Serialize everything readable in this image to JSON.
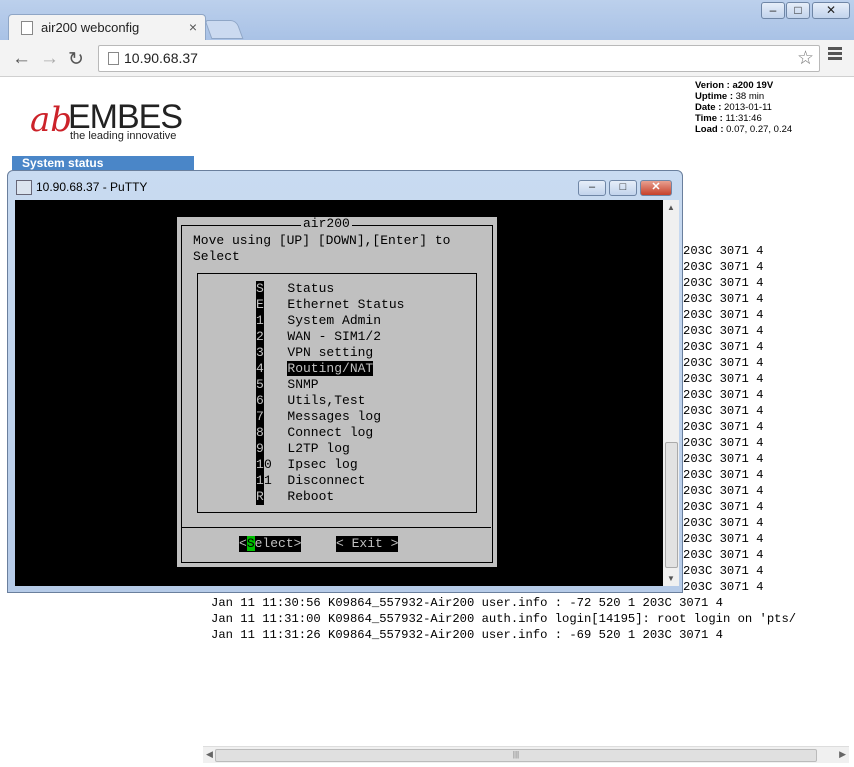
{
  "browser": {
    "tab_title": "air200 webconfig",
    "tab_close": "×",
    "url": "10.90.68.37",
    "back_icon": "←",
    "forward_icon": "→",
    "reload_icon": "↻",
    "star_icon": "☆"
  },
  "logo": {
    "name": "EMBES",
    "tagline": "the leading innovative"
  },
  "status": {
    "version_label": "Verion :",
    "version_value": "a200 19V",
    "uptime_label": "Uptime :",
    "uptime_value": "38 min",
    "date_label": "Date :",
    "date_value": "2013-01-11",
    "time_label": "Time :",
    "time_value": "11:31:46",
    "load_label": "Load :",
    "load_value": "0.07, 0.27, 0.24"
  },
  "nav": {
    "system_status": "System status"
  },
  "log": {
    "right_fragment": "203C 3071 4",
    "right_count": 22,
    "lines": [
      "Jan 11 11:30:56 K09864_557932-Air200 user.info : -72 520 1 203C 3071 4",
      "Jan 11 11:31:00 K09864_557932-Air200 auth.info login[14195]: root login on 'pts/",
      "Jan 11 11:31:26 K09864_557932-Air200 user.info : -69 520 1 203C 3071 4"
    ]
  },
  "putty": {
    "title": "10.90.68.37 - PuTTY",
    "dialog_title": "air200",
    "prompt_line1": "Move using [UP] [DOWN],[Enter] to",
    "prompt_line2": "Select",
    "selected_index": 5,
    "menu": [
      {
        "key": "S",
        "label": "Status"
      },
      {
        "key": "E",
        "label": "Ethernet Status"
      },
      {
        "key": "1",
        "label": "System Admin"
      },
      {
        "key": "2",
        "label": "WAN - SIM1/2"
      },
      {
        "key": "3",
        "label": "VPN setting"
      },
      {
        "key": "4",
        "label": "Routing/NAT"
      },
      {
        "key": "5",
        "label": "SNMP"
      },
      {
        "key": "6",
        "label": "Utils,Test"
      },
      {
        "key": "7",
        "label": "Messages log"
      },
      {
        "key": "8",
        "label": "Connect log"
      },
      {
        "key": "9",
        "label": "L2TP log"
      },
      {
        "key": "10",
        "label": "Ipsec log"
      },
      {
        "key": "11",
        "label": "Disconnect"
      },
      {
        "key": "R",
        "label": "Reboot"
      }
    ],
    "select_btn_pre": "<",
    "select_btn_hot": "S",
    "select_btn_post": "elect>",
    "exit_btn": "< Exit >"
  }
}
